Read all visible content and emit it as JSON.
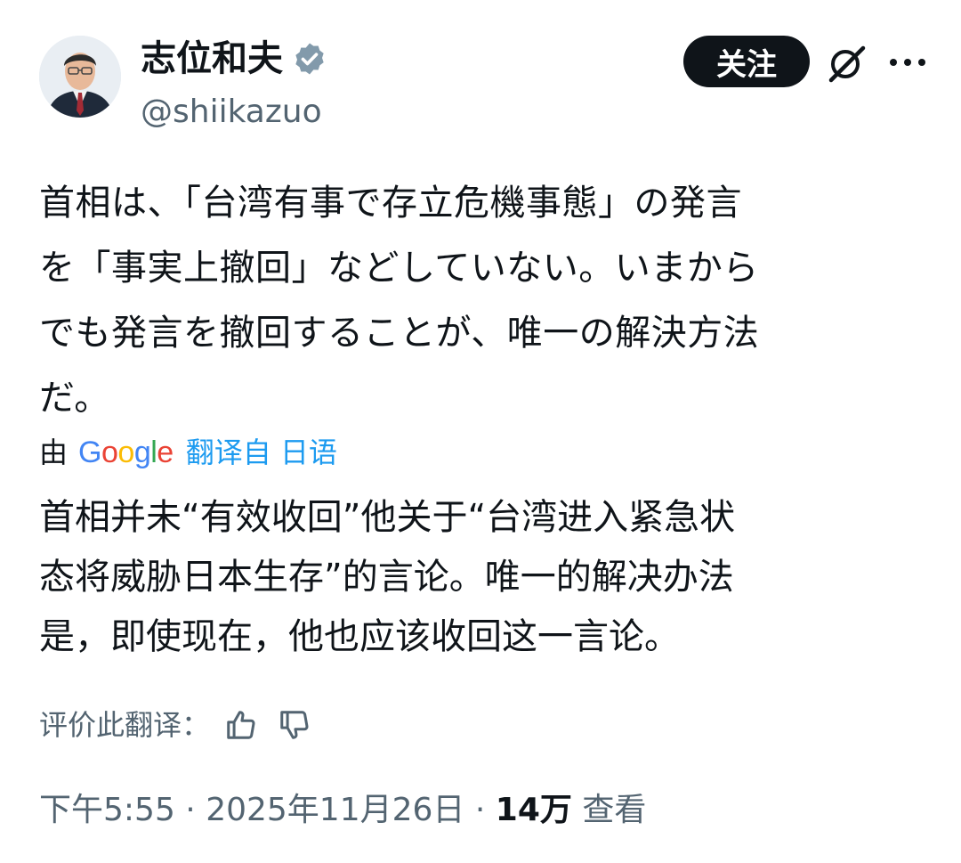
{
  "author": {
    "display_name": "志位和夫",
    "handle": "@shiikazuo",
    "verified": true
  },
  "actions": {
    "follow_label": "关注",
    "grok_icon": "grok-icon",
    "more_icon": "more-icon"
  },
  "tweet": {
    "lines": [
      "首相は、「台湾有事で存立危機事態」の発言",
      "を「事実上撤回」などしていない。いまから",
      "でも発言を撤回することが、唯一の解決方法",
      "だ。"
    ]
  },
  "translation": {
    "by_label": "由",
    "provider": "Google",
    "link_label": "翻译自 日语",
    "lines": [
      "首相并未“有效收回”他关于“台湾进入紧急状",
      "态将威胁日本生存”的言论。唯一的解决办法",
      "是，即使现在，他也应该收回这一言论。"
    ],
    "rate_label": "评价此翻译：",
    "thumbs_up_icon": "thumbs-up-icon",
    "thumbs_down_icon": "thumbs-down-icon"
  },
  "meta": {
    "time": "下午5:55",
    "separator": " · ",
    "date": "2025年11月26日",
    "views_count": "14万",
    "views_label": " 查看"
  },
  "colors": {
    "text_primary": "#0f1419",
    "text_secondary": "#536471",
    "link_blue": "#1d9bf0",
    "follow_bg": "#0f1419",
    "verified_badge": "#829aab",
    "google_blue": "#4285F4",
    "google_red": "#EA4335",
    "google_yellow": "#FBBC05",
    "google_green": "#34A853"
  }
}
